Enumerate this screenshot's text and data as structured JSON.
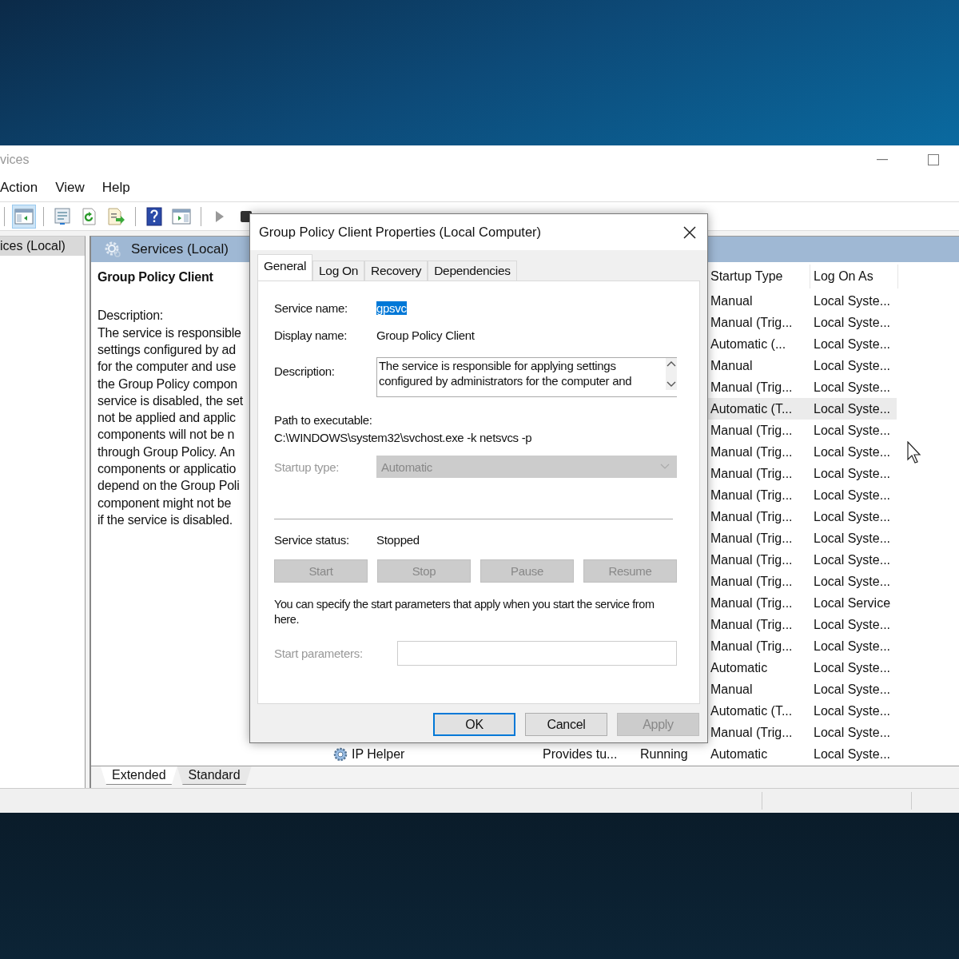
{
  "window": {
    "title": "vices"
  },
  "menu": [
    {
      "label": "Action"
    },
    {
      "label": "View"
    },
    {
      "label": "Help"
    }
  ],
  "toolbar": {
    "console_tree_selected": true
  },
  "tree": {
    "items": [
      {
        "label": "ices (Local)",
        "selected": true
      }
    ]
  },
  "pane": {
    "header": "Services (Local)",
    "service_title": "Group Policy Client",
    "description_label": "Description:",
    "description_lines": [
      "The service is responsible",
      "settings configured by ad",
      "for the computer and use",
      "the Group Policy compon",
      "service is disabled, the set",
      "not be applied and applic",
      "components will not be n",
      "through Group Policy. An",
      "components or applicatio",
      "depend on the Group Poli",
      "component might not be",
      "if the service is disabled."
    ]
  },
  "list": {
    "columns": [
      {
        "label": "Startup Type"
      },
      {
        "label": "Log On As"
      }
    ],
    "rows": [
      {
        "startup": "Manual",
        "log_on_as": "Local Syste...",
        "selected": false
      },
      {
        "startup": "Manual (Trig...",
        "log_on_as": "Local Syste...",
        "selected": false
      },
      {
        "startup": "Automatic (...",
        "log_on_as": "Local Syste...",
        "selected": false
      },
      {
        "startup": "Manual",
        "log_on_as": "Local Syste...",
        "selected": false
      },
      {
        "startup": "Manual (Trig...",
        "log_on_as": "Local Syste...",
        "selected": false
      },
      {
        "startup": "Automatic (T...",
        "log_on_as": "Local Syste...",
        "selected": true
      },
      {
        "startup": "Manual (Trig...",
        "log_on_as": "Local Syste...",
        "selected": false
      },
      {
        "startup": "Manual (Trig...",
        "log_on_as": "Local Syste...",
        "selected": false
      },
      {
        "startup": "Manual (Trig...",
        "log_on_as": "Local Syste...",
        "selected": false
      },
      {
        "startup": "Manual (Trig...",
        "log_on_as": "Local Syste...",
        "selected": false
      },
      {
        "startup": "Manual (Trig...",
        "log_on_as": "Local Syste...",
        "selected": false
      },
      {
        "startup": "Manual (Trig...",
        "log_on_as": "Local Syste...",
        "selected": false
      },
      {
        "startup": "Manual (Trig...",
        "log_on_as": "Local Syste...",
        "selected": false
      },
      {
        "startup": "Manual (Trig...",
        "log_on_as": "Local Syste...",
        "selected": false
      },
      {
        "startup": "Manual (Trig...",
        "log_on_as": "Local Service",
        "selected": false
      },
      {
        "startup": "Manual (Trig...",
        "log_on_as": "Local Syste...",
        "selected": false
      },
      {
        "startup": "Manual (Trig...",
        "log_on_as": "Local Syste...",
        "selected": false
      },
      {
        "startup": "Automatic",
        "log_on_as": "Local Syste...",
        "selected": false
      },
      {
        "startup": "Manual",
        "log_on_as": "Local Syste...",
        "selected": false
      },
      {
        "startup": "Automatic (T...",
        "log_on_as": "Local Syste...",
        "selected": false
      },
      {
        "startup": "Manual (Trig...",
        "log_on_as": "Local Syste...",
        "selected": false
      },
      {
        "name": "IP Helper",
        "description": "Provides tu...",
        "status": "Running",
        "startup": "Automatic",
        "log_on_as": "Local Syste...",
        "selected": false
      }
    ]
  },
  "view_tabs": [
    {
      "label": "Extended",
      "selected": true
    },
    {
      "label": "Standard",
      "selected": false
    }
  ],
  "dialog": {
    "title": "Group Policy Client Properties (Local Computer)",
    "tabs": [
      {
        "label": "General",
        "selected": true
      },
      {
        "label": "Log On",
        "selected": false
      },
      {
        "label": "Recovery",
        "selected": false
      },
      {
        "label": "Dependencies",
        "selected": false
      }
    ],
    "service_name": {
      "label": "Service name:",
      "value": "gpsvc",
      "value_selected": true
    },
    "display_name": {
      "label": "Display name:",
      "value": "Group Policy Client"
    },
    "description": {
      "label": "Description:",
      "lines": [
        "The service is responsible for applying settings",
        "configured by administrators for the computer and"
      ]
    },
    "path": {
      "label": "Path to executable:",
      "value": "C:\\WINDOWS\\system32\\svchost.exe -k netsvcs -p"
    },
    "startup_type": {
      "label": "Startup type:",
      "value": "Automatic",
      "disabled": true
    },
    "service_status": {
      "label": "Service status:",
      "value": "Stopped"
    },
    "control_buttons": [
      {
        "label": "Start",
        "disabled": true
      },
      {
        "label": "Stop",
        "disabled": true
      },
      {
        "label": "Pause",
        "disabled": true
      },
      {
        "label": "Resume",
        "disabled": true
      }
    ],
    "hint": "You can specify the start parameters that apply when you start the service from here.",
    "start_parameters": {
      "label": "Start parameters:",
      "disabled": true
    },
    "buttons": [
      {
        "label": "OK",
        "default": true,
        "disabled": false
      },
      {
        "label": "Cancel",
        "default": false,
        "disabled": false
      },
      {
        "label": "Apply",
        "default": false,
        "disabled": true
      }
    ]
  }
}
